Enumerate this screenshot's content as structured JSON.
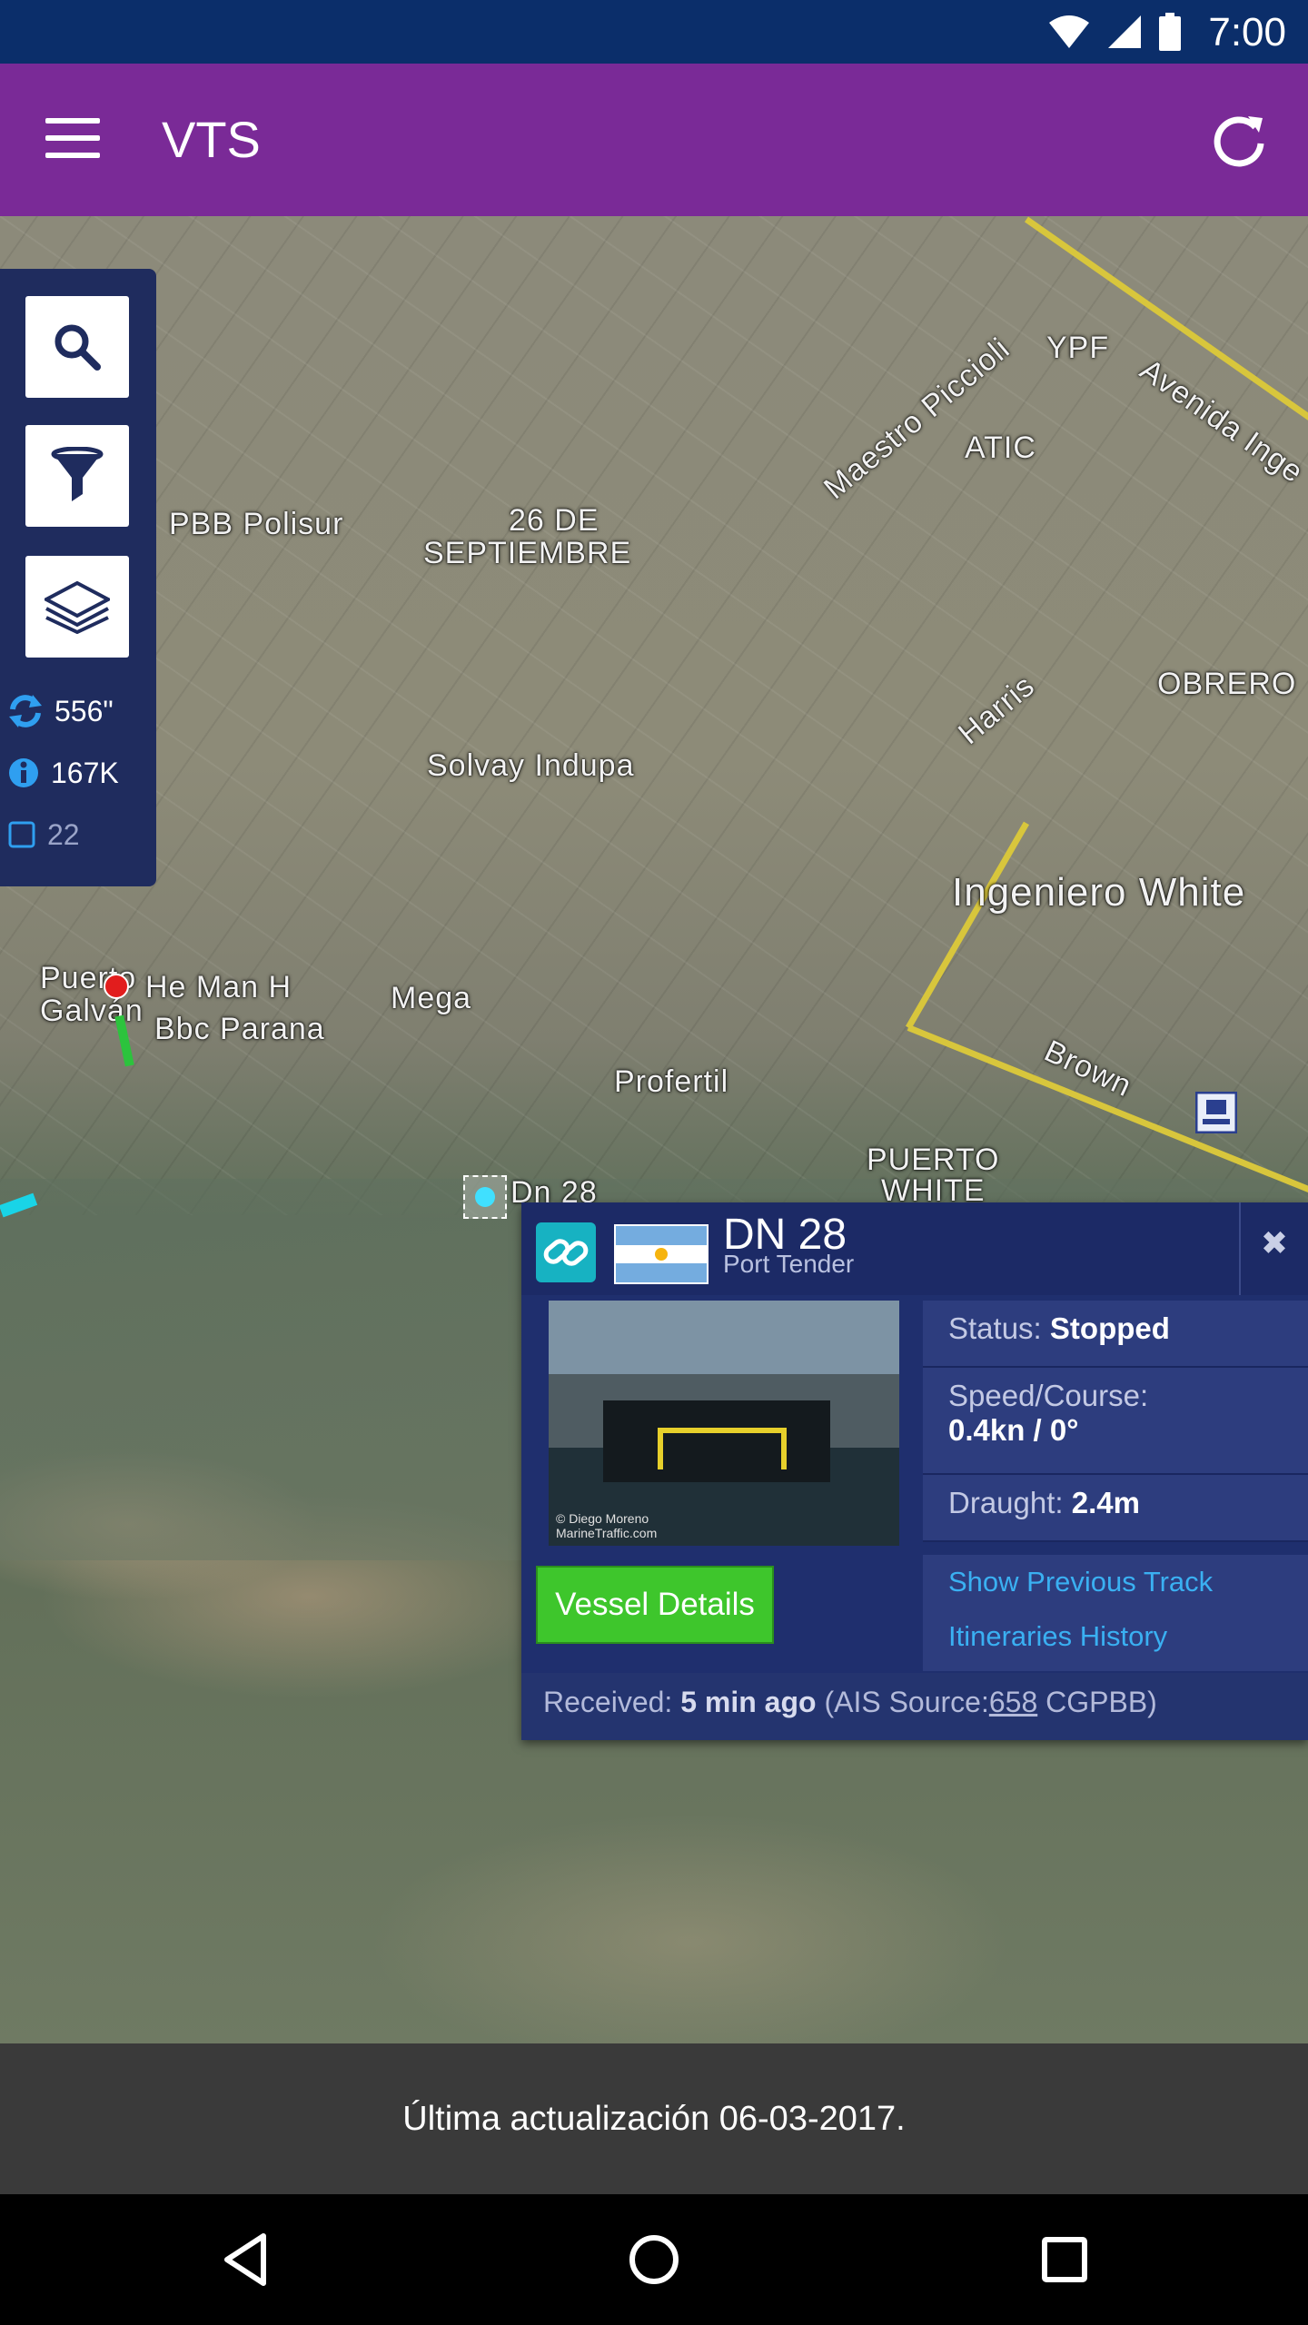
{
  "status_bar": {
    "time": "7:00",
    "icons": [
      "wifi-icon",
      "signal-icon",
      "battery-icon"
    ]
  },
  "app_bar": {
    "title": "VTS",
    "menu_icon": "menu-icon",
    "refresh_icon": "refresh-icon"
  },
  "map": {
    "labels": [
      {
        "text": "PBB Polisur"
      },
      {
        "text": "26 DE"
      },
      {
        "text": "SEPTIEMBRE"
      },
      {
        "text": "Solvay Indupa"
      },
      {
        "text": "YPF"
      },
      {
        "text": "ATIC"
      },
      {
        "text": "OBRERO"
      },
      {
        "text": "Ingeniero White"
      },
      {
        "text": "Mega"
      },
      {
        "text": "Profertil"
      },
      {
        "text": "Puerto"
      },
      {
        "text": "Galván"
      },
      {
        "text": "He Man H"
      },
      {
        "text": "Bbc Parana"
      },
      {
        "text": "PUERTO"
      },
      {
        "text": "WHITE"
      },
      {
        "text": "Dn 28"
      },
      {
        "text": "Maestro Piccioli"
      },
      {
        "text": "Avenida Inge"
      },
      {
        "text": "Harris"
      },
      {
        "text": "Brown"
      }
    ]
  },
  "tool_panel": {
    "buttons": [
      "search-icon",
      "filter-icon",
      "layers-icon"
    ],
    "stats": {
      "refresh_value": "556\"",
      "info_value": "167K",
      "count_value": "22"
    }
  },
  "vessel_popup": {
    "name": "DN 28",
    "type": "Port Tender",
    "status_label": "Status:",
    "status_value": "Stopped",
    "speed_label": "Speed/Course:",
    "speed_value": "0.4kn / 0°",
    "draught_label": "Draught:",
    "draught_value": "2.4m",
    "link_previous_track": "Show Previous Track",
    "link_itineraries": "Itineraries History",
    "details_button": "Vessel Details",
    "received_label": "Received:",
    "received_value": "5 min ago",
    "source_prefix": "(AIS Source:",
    "source_id": "658",
    "source_suffix": "CGPBB)",
    "photo_credit_line1": "© Diego Moreno",
    "photo_credit_line2": "MarineTraffic.com",
    "flag": "Argentina"
  },
  "snackbar": {
    "text": "Última actualización 06-03-2017."
  },
  "nav_bar": {
    "buttons": [
      "back-icon",
      "home-icon",
      "recents-icon"
    ]
  }
}
